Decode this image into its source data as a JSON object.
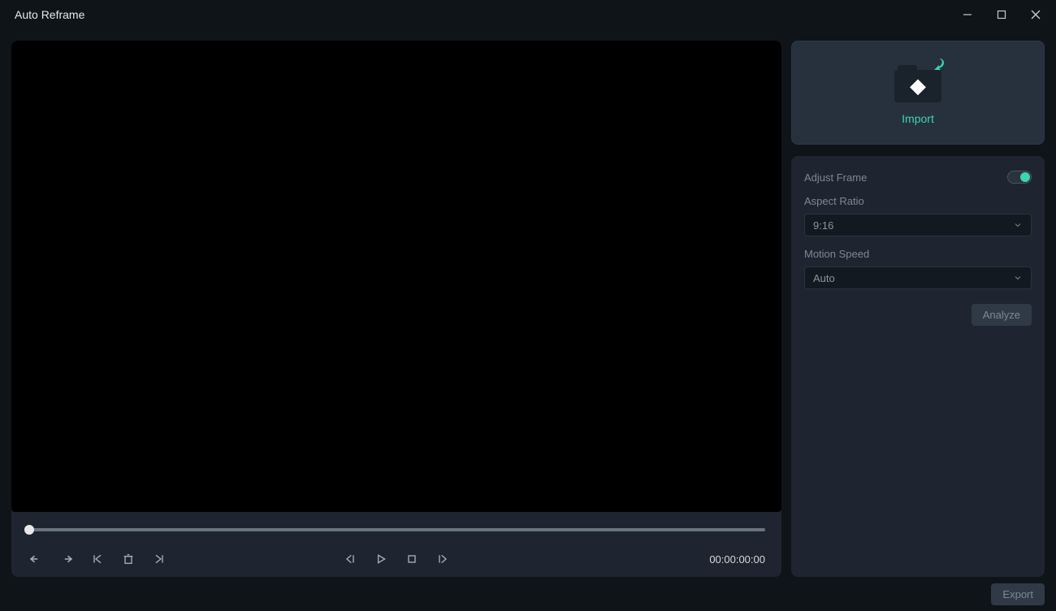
{
  "window": {
    "title": "Auto Reframe"
  },
  "import": {
    "label": "Import"
  },
  "settings": {
    "adjust_frame_label": "Adjust Frame",
    "aspect_ratio_label": "Aspect Ratio",
    "aspect_ratio_value": "9:16",
    "motion_speed_label": "Motion Speed",
    "motion_speed_value": "Auto",
    "analyze_label": "Analyze"
  },
  "player": {
    "timecode": "00:00:00:00"
  },
  "footer": {
    "export_label": "Export"
  }
}
